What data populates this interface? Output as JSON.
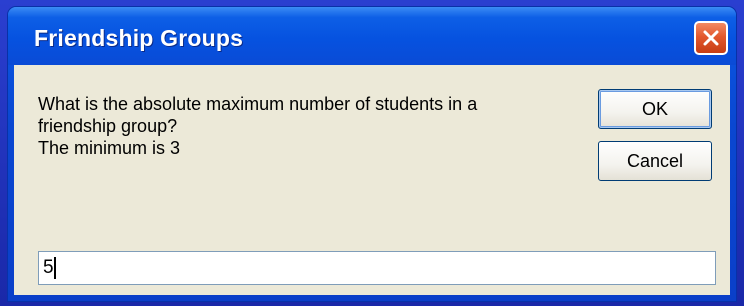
{
  "window": {
    "title": "Friendship Groups",
    "close_icon": "close-icon"
  },
  "prompt": {
    "line1": "What is the absolute maximum number of students in a",
    "line2": "friendship group?",
    "line3": "The minimum is 3"
  },
  "buttons": {
    "ok_label": "OK",
    "cancel_label": "Cancel"
  },
  "input": {
    "value": "5"
  },
  "colors": {
    "titlebar": "#0652e0",
    "dialog_face": "#ece9d8",
    "close_button": "#e3582e"
  }
}
